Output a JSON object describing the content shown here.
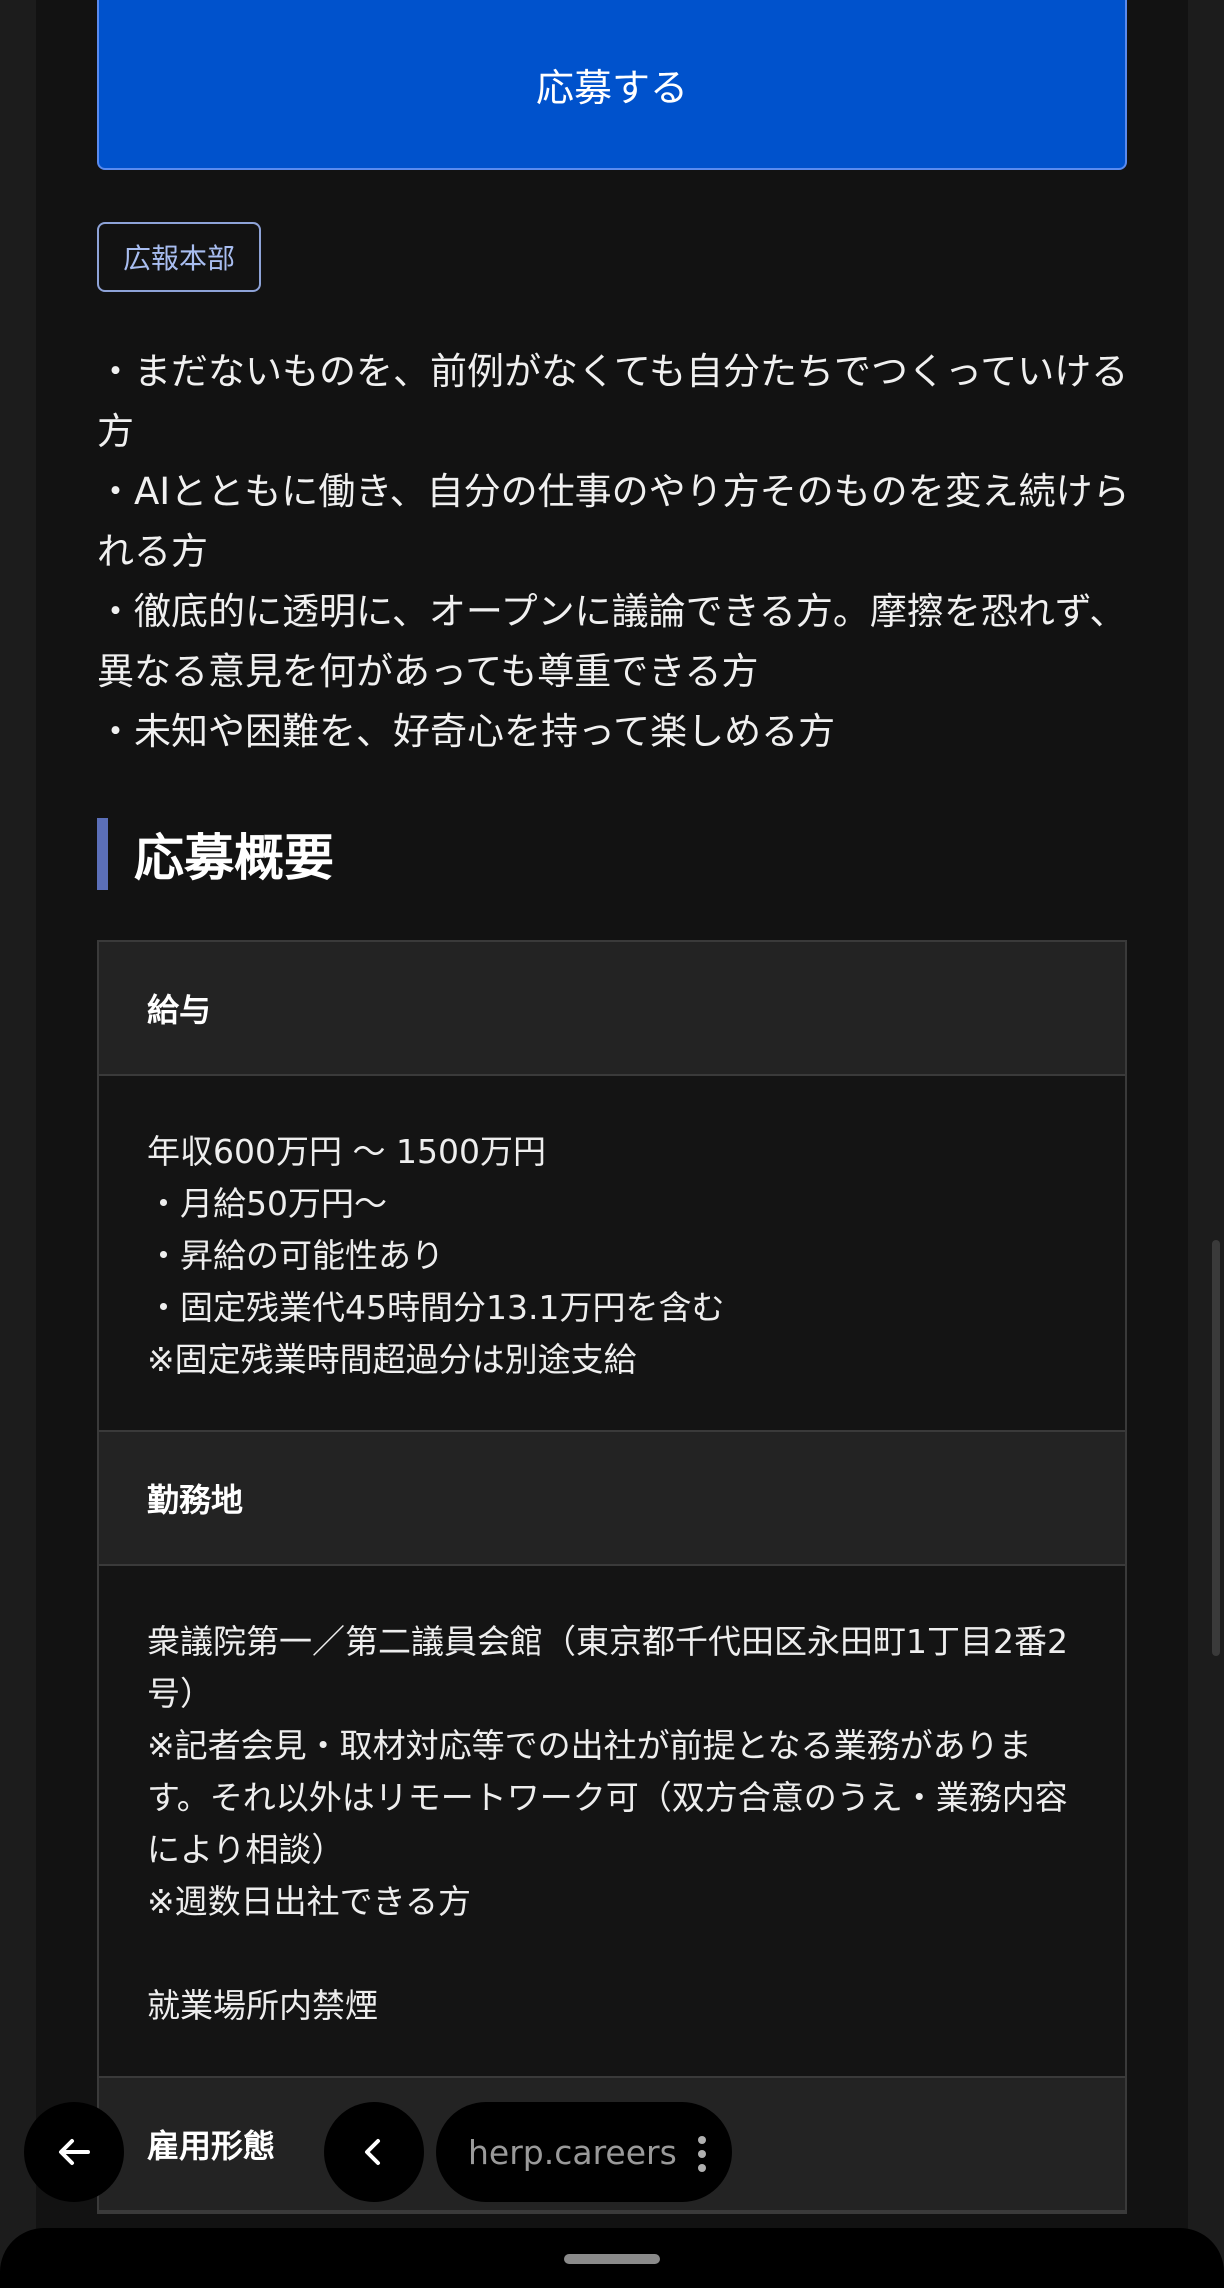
{
  "apply_button": {
    "label": "応募する"
  },
  "department_badge": "広報本部",
  "requirements": [
    "・まだないものを、前例がなくても自分たちでつくっていける方",
    "・AIとともに働き、自分の仕事のやり方そのものを変え続けられる方",
    "・徹底的に透明に、オープンに議論できる方。摩擦を恐れず、異なる意見を何があっても尊重できる方",
    "・未知や困難を、好奇心を持って楽しめる方"
  ],
  "summary": {
    "title": "応募概要",
    "salary": {
      "heading": "給与",
      "lines": [
        "年収600万円 〜 1500万円",
        "・月給50万円〜",
        "・昇給の可能性あり",
        "・固定残業代45時間分13.1万円を含む",
        "※固定残業時間超過分は別途支給"
      ]
    },
    "location": {
      "heading": "勤務地",
      "lines": [
        "衆議院第一／第二議員会館（東京都千代田区永田町1丁目2番2号）",
        "※記者会見・取材対応等での出社が前提となる業務があります。それ以外はリモートワーク可（双方合意のうえ・業務内容により相談）",
        "※週数日出社できる方",
        "",
        "就業場所内禁煙"
      ]
    },
    "employment": {
      "heading": "雇用形態"
    }
  },
  "browser": {
    "url": "herp.careers",
    "back_icon": "arrow-left-icon",
    "prev_icon": "chevron-left-icon",
    "menu_icon": "more-vertical-icon"
  },
  "colors": {
    "page_bg": "#121212",
    "apply_button_bg": "#0052cc",
    "section_accent": "#5b6fb8",
    "badge_text": "#a8bdf0"
  }
}
